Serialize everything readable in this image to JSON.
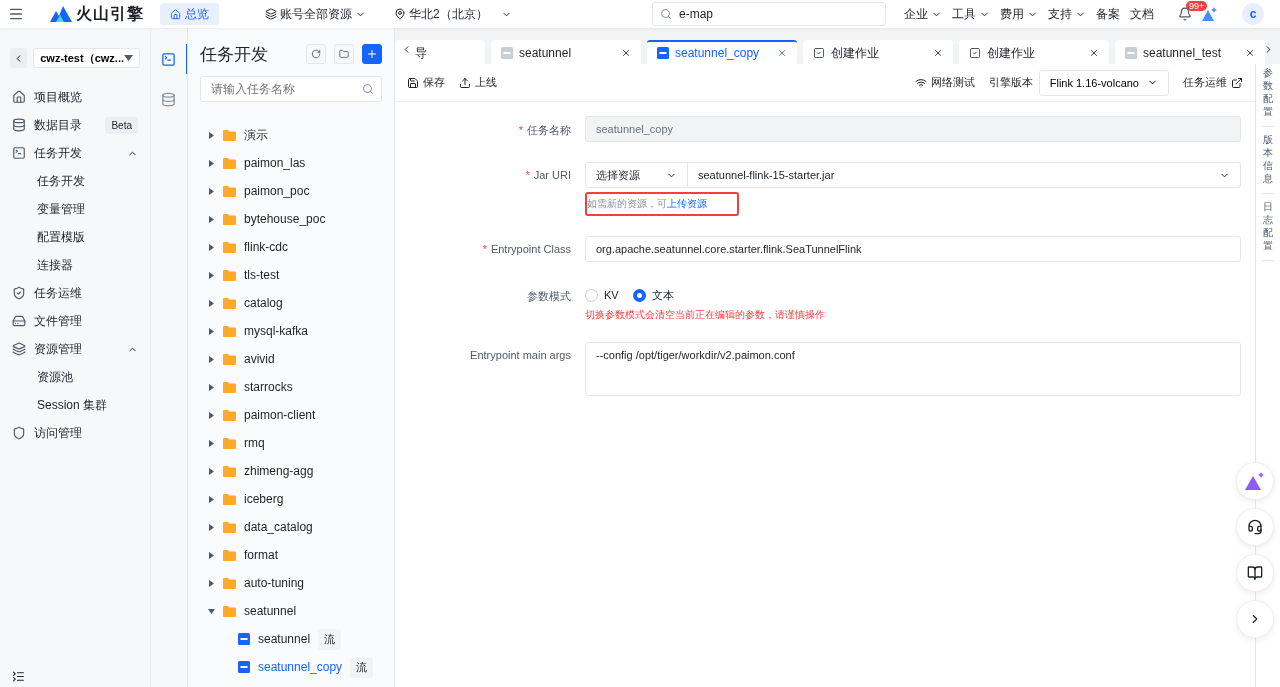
{
  "header": {
    "logo": "火山引擎",
    "home": "总览",
    "account": "账号全部资源",
    "region": "华北2（北京）",
    "search": {
      "value": "e-map"
    },
    "menus": [
      {
        "label": "企业",
        "dropdown": true
      },
      {
        "label": "工具",
        "dropdown": true
      },
      {
        "label": "费用",
        "dropdown": true
      },
      {
        "label": "支持",
        "dropdown": true
      },
      {
        "label": "备案",
        "dropdown": false
      },
      {
        "label": "文档",
        "dropdown": false
      }
    ],
    "notifications": "99+",
    "avatar": "c"
  },
  "sidebar": {
    "project": "cwz-test（cwz...",
    "items": [
      {
        "label": "项目概览"
      },
      {
        "label": "数据目录",
        "badge": "Beta"
      },
      {
        "label": "任务开发",
        "expanded": true,
        "children": [
          {
            "label": "任务开发"
          },
          {
            "label": "变量管理"
          },
          {
            "label": "配置模版"
          },
          {
            "label": "连接器"
          }
        ]
      },
      {
        "label": "任务运维"
      },
      {
        "label": "文件管理"
      },
      {
        "label": "资源管理",
        "expanded": true,
        "children": [
          {
            "label": "资源池"
          },
          {
            "label": "Session 集群"
          }
        ]
      },
      {
        "label": "访问管理"
      }
    ]
  },
  "tool_rail": [
    {
      "selected": true
    },
    {
      "selected": false
    }
  ],
  "tree_panel": {
    "title": "任务开发",
    "search": {
      "placeholder": "请输入任务名称"
    },
    "nodes": [
      {
        "label": "演示",
        "expanded": false
      },
      {
        "label": "paimon_las",
        "expanded": false
      },
      {
        "label": "paimon_poc",
        "expanded": false
      },
      {
        "label": "bytehouse_poc",
        "expanded": false
      },
      {
        "label": "flink-cdc",
        "expanded": false
      },
      {
        "label": "tls-test",
        "expanded": false
      },
      {
        "label": "catalog",
        "expanded": false
      },
      {
        "label": "mysql-kafka",
        "expanded": false
      },
      {
        "label": "avivid",
        "expanded": false
      },
      {
        "label": "starrocks",
        "expanded": false
      },
      {
        "label": "paimon-client",
        "expanded": false
      },
      {
        "label": "rmq",
        "expanded": false
      },
      {
        "label": "zhimeng-agg",
        "expanded": false
      },
      {
        "label": "iceberg",
        "expanded": false
      },
      {
        "label": "data_catalog",
        "expanded": false
      },
      {
        "label": "format",
        "expanded": false
      },
      {
        "label": "auto-tuning",
        "expanded": false
      },
      {
        "label": "seatunnel",
        "expanded": true,
        "children": [
          {
            "label": "seatunnel",
            "tag": "流",
            "selected": false
          },
          {
            "label": "seatunnel_copy",
            "tag": "流",
            "selected": true
          }
        ]
      }
    ]
  },
  "tabs": [
    {
      "label": "导",
      "kind": "cut",
      "selected": false
    },
    {
      "label": "seatunnel",
      "kind": "jar",
      "selected": false
    },
    {
      "label": "seatunnel_copy",
      "kind": "jar",
      "selected": true
    },
    {
      "label": "创建作业",
      "kind": "task",
      "selected": false
    },
    {
      "label": "创建作业",
      "kind": "task",
      "selected": false
    },
    {
      "label": "seatunnel_test",
      "kind": "jar",
      "selected": false
    }
  ],
  "toolbar": {
    "save": "保存",
    "publish": "上线",
    "network_test": "网络测试",
    "engine_label": "引擎版本",
    "engine": "Flink 1.16-volcano",
    "ops": "任务运维"
  },
  "form": {
    "name": {
      "label": "任务名称",
      "required_mark": "*",
      "value": "seatunnel_copy",
      "disabled": true
    },
    "jar": {
      "label": "Jar URI",
      "required_mark": "*",
      "source": "选择资源",
      "value": "seatunnel-flink-15-starter.jar",
      "hint": "如需新的资源，可",
      "link": "上传资源",
      "highlighted": true
    },
    "entry_class": {
      "label": "Entrypoint Class",
      "required_mark": "*",
      "value": "org.apache.seatunnel.core.starter.flink.SeaTunnelFlink"
    },
    "mode": {
      "label": "参数模式",
      "options": [
        {
          "label": "KV",
          "selected": false
        },
        {
          "label": "文本",
          "selected": true
        }
      ],
      "warning": "切换参数模式会清空当前正在编辑的参数，请谨慎操作"
    },
    "args": {
      "label": "Entrypoint main args",
      "value": "--config /opt/tiger/workdir/v2.paimon.conf"
    }
  },
  "side_tabs": [
    "参数配置",
    "版本信息",
    "日志配置"
  ]
}
